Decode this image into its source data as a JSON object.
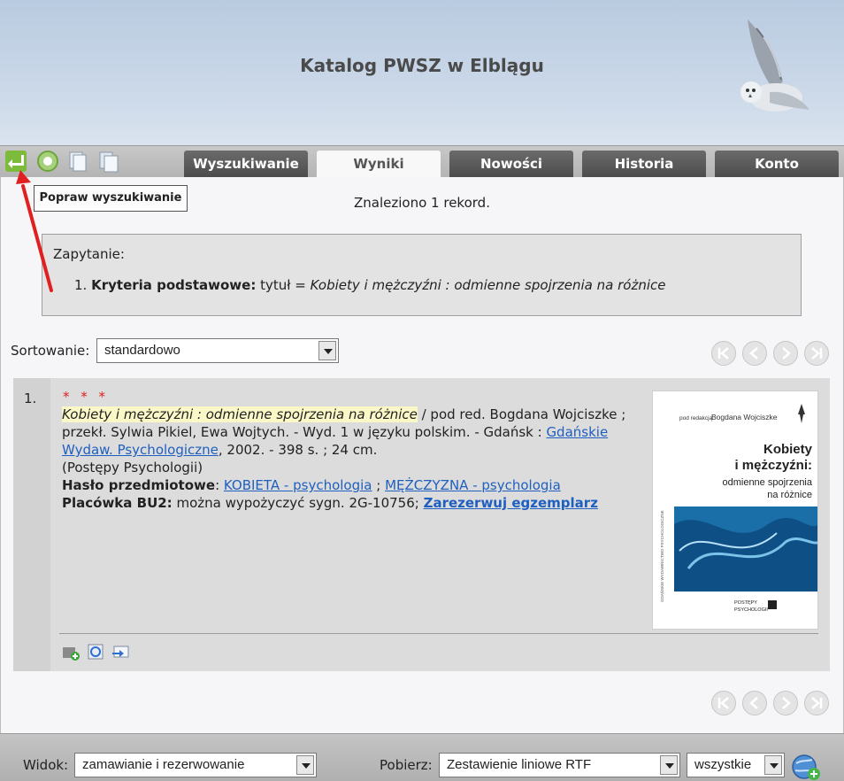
{
  "header": {
    "title": "Katalog PWSZ w Elblągu"
  },
  "toolbar": {
    "icons": [
      "back-arrow-icon",
      "refresh-icon",
      "copy-icon",
      "paste-icon"
    ],
    "tooltip": "Popraw wyszukiwanie"
  },
  "tabs": [
    {
      "label": "Wyszukiwanie",
      "active": false
    },
    {
      "label": "Wyniki",
      "active": true
    },
    {
      "label": "Nowości",
      "active": false
    },
    {
      "label": "Historia",
      "active": false
    },
    {
      "label": "Konto",
      "active": false
    }
  ],
  "results": {
    "found_text": "Znaleziono 1 rekord."
  },
  "query": {
    "heading": "Zapytanie:",
    "items": [
      {
        "number": "1.",
        "label": "Kryteria podstawowe:",
        "field": "tytuł =",
        "value": "Kobiety i mężczyźni : odmienne spojrzenia na różnice"
      }
    ]
  },
  "sort": {
    "label": "Sortowanie:",
    "value": "standardowo"
  },
  "record": {
    "number": "1.",
    "stars": "* * *",
    "title": "Kobiety i mężczyźni : odmienne spojrzenia na różnice",
    "resp": " / pod red. Bogdana Wojciszke ; przekł. Sylwia Pikiel, Ewa Wojtych. - Wyd. 1 w języku polskim. - Gdańsk : ",
    "publisher_link": "Gdańskie Wydaw. Psychologiczne",
    "pub_rest": ", 2002. - 398 s. ; 24 cm.",
    "series": "(Postępy Psychologii)",
    "subject_label": "Hasło przedmiotowe",
    "subject_1": "KOBIETA - psychologia",
    "subject_sep": " ; ",
    "subject_2": "MĘŻCZYZNA - psychologia",
    "holding_label": "Placówka BU2:",
    "holding_text": " można wypożyczyć sygn. 2G-10756; ",
    "reserve_link": "Zarezerwuj egzemplarz",
    "cover": {
      "editor_prefix": "pod redakcją",
      "editor": "Bogdana Wojciszke",
      "title_1": "Kobiety",
      "title_2": "i mężczyźni:",
      "subtitle_1": "odmienne spojrzenia",
      "subtitle_2": "na różnice",
      "spine": "GDAŃSKIE WYDAWNICTWO PSYCHOLOGICZNE",
      "series_1": "POSTĘPY",
      "series_2": "PSYCHOLOGII"
    },
    "tools": [
      "add-to-basket-icon",
      "refresh-record-icon",
      "send-icon"
    ]
  },
  "footer": {
    "view_label": "Widok:",
    "view_value": "zamawianie i rezerwowanie",
    "download_label": "Pobierz:",
    "download_value": "Zestawienie liniowe RTF",
    "scope_value": "wszystkie"
  },
  "colors": {
    "tab": "#555555",
    "link": "#1f5fbf",
    "stars": "#e02020",
    "annotation": "#e02020"
  }
}
